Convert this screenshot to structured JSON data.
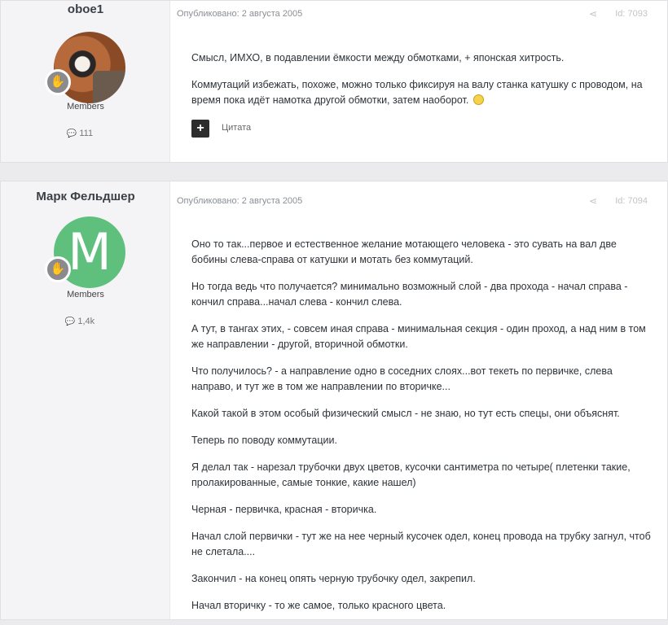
{
  "posts": [
    {
      "author": "oboe1",
      "group": "Members",
      "post_count": "111",
      "published": "Опубликовано: 2 августа 2005",
      "post_id": "Id: 7093",
      "paragraphs": [
        "Смысл, ИМХО, в подавлении ёмкости между обмотками, + японская хитрость.",
        "Коммутаций избежать, похоже, можно только фиксируя на валу станка катушку с проводом, на время пока идёт намотка другой обмотки, затем наоборот."
      ],
      "quote_label": "Цитата"
    },
    {
      "author": "Марк Фельдшер",
      "avatar_letter": "M",
      "group": "Members",
      "post_count": "1,4k",
      "published": "Опубликовано: 2 августа 2005",
      "post_id": "Id: 7094",
      "paragraphs": [
        "Оно то так...первое и естественное желание мотающего человека - это сувать на вал две бобины слева-справа от катушки и мотать без коммутаций.",
        "Но тогда ведь что получается? минимально возможный слой - два прохода - начал справа - кончил справа...начал слева - кончил слева.",
        "А тут, в тангах этих, - совсем иная справа - минимальная секция - один проход, а над ним в том же направлении - другой, вторичной обмотки.",
        "Что получилось? - а направление одно в соседних слоях...вот текеть по первичке, слева направо, и тут же в том же направлении по вторичке...",
        "Какой такой в этом особый физический смысл - не знаю, но тут есть спецы, они объяснят.",
        "Теперь по поводу коммутации.",
        "Я делал так - нарезал трубочки двух цветов, кусочки сантиметра по четыре( плетенки такие, пролакированные, самые тонкие, какие нашел)",
        "Черная - первичка, красная - вторичка.",
        "Начал слой первички - тут же на нее черный кусочек одел, конец провода на трубку загнул, чтоб не слетала....",
        "Закончил - на конец опять черную трубочку одел, закрепил.",
        "Начал вторичку - то же самое, только красного цвета."
      ]
    }
  ],
  "icons": {
    "rank": "hand-badge-icon",
    "comments": "speech-bubble-icon",
    "share": "share-icon",
    "smile": "smile-emoji-icon",
    "plus": "plus-icon"
  },
  "colors": {
    "avatar_green": "#5fc07e",
    "sidebar_bg": "#f4f4f6"
  }
}
